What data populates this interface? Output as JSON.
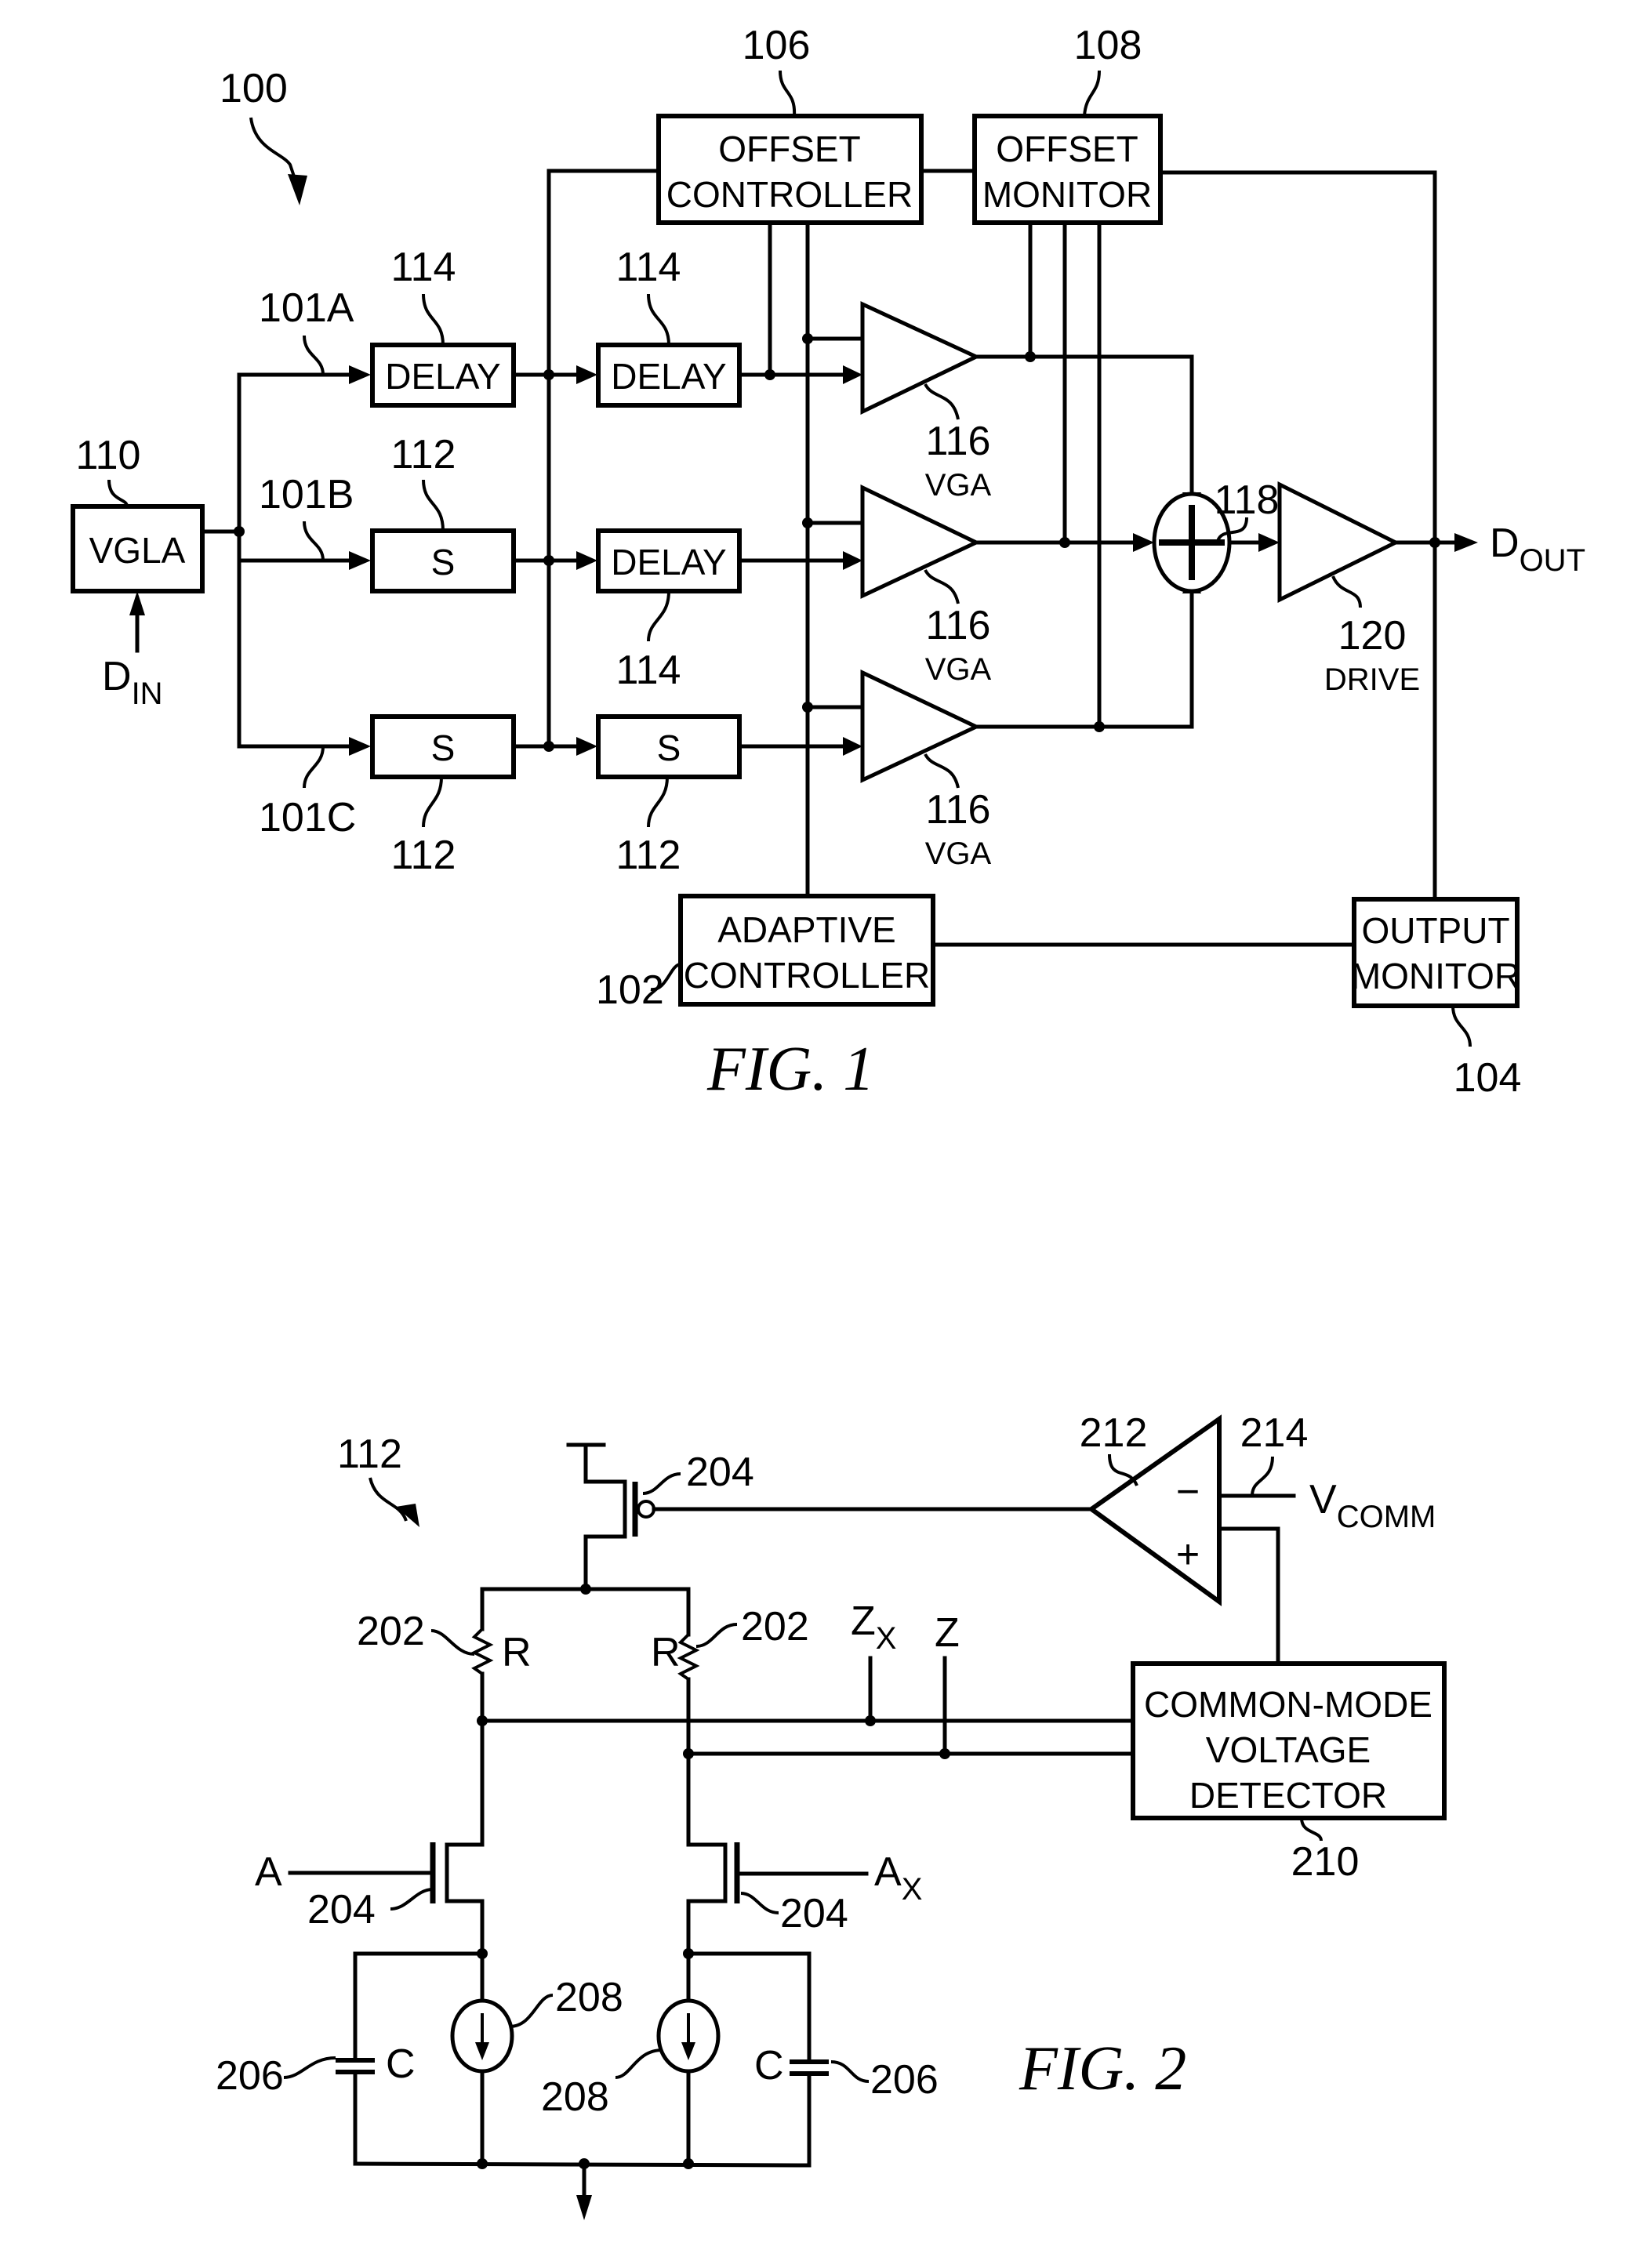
{
  "fig1": {
    "caption": "FIG. 1",
    "system_ref": "100",
    "blocks": {
      "vgla": {
        "label": "VGLA",
        "ref": "110"
      },
      "offset_controller": {
        "line1": "OFFSET",
        "line2": "CONTROLLER",
        "ref": "106"
      },
      "offset_monitor": {
        "line1": "OFFSET",
        "line2": "MONITOR",
        "ref": "108"
      },
      "adaptive_controller": {
        "line1": "ADAPTIVE",
        "line2": "CONTROLLER",
        "ref": "102"
      },
      "output_monitor": {
        "line1": "OUTPUT",
        "line2": "MONITOR",
        "ref": "104"
      },
      "delay_a1": {
        "label": "DELAY",
        "ref": "114"
      },
      "delay_a2": {
        "label": "DELAY",
        "ref": "114"
      },
      "s_b1": {
        "label": "S",
        "ref": "112"
      },
      "delay_b2": {
        "label": "DELAY",
        "ref": "114"
      },
      "s_c1": {
        "label": "S",
        "ref": "112"
      },
      "s_c2": {
        "label": "S",
        "ref": "112"
      }
    },
    "paths": {
      "a": "101A",
      "b": "101B",
      "c": "101C"
    },
    "vga": {
      "ref": "116",
      "label": "VGA"
    },
    "summer": {
      "ref": "118"
    },
    "drive": {
      "ref": "120",
      "label": "DRIVE"
    },
    "input": {
      "main": "D",
      "sub": "IN"
    },
    "output": {
      "main": "D",
      "sub": "OUT"
    }
  },
  "fig2": {
    "caption": "FIG. 2",
    "system_ref": "112",
    "pmos_ref": "204",
    "resistor": {
      "ref": "202",
      "label": "R"
    },
    "nmos_ref": "204",
    "capacitor": {
      "ref": "206",
      "label": "C"
    },
    "current_source_ref": "208",
    "amp_ref": "212",
    "amp_minus": "−",
    "amp_plus": "+",
    "vcomm_ref": "214",
    "vcomm": {
      "main": "V",
      "sub": "COMM"
    },
    "detector": {
      "line1": "COMMON-MODE",
      "line2": "VOLTAGE",
      "line3": "DETECTOR",
      "ref": "210"
    },
    "input_a": "A",
    "input_ax": {
      "main": "A",
      "sub": "X"
    },
    "out_zx": {
      "main": "Z",
      "sub": "X"
    },
    "out_z": "Z"
  }
}
